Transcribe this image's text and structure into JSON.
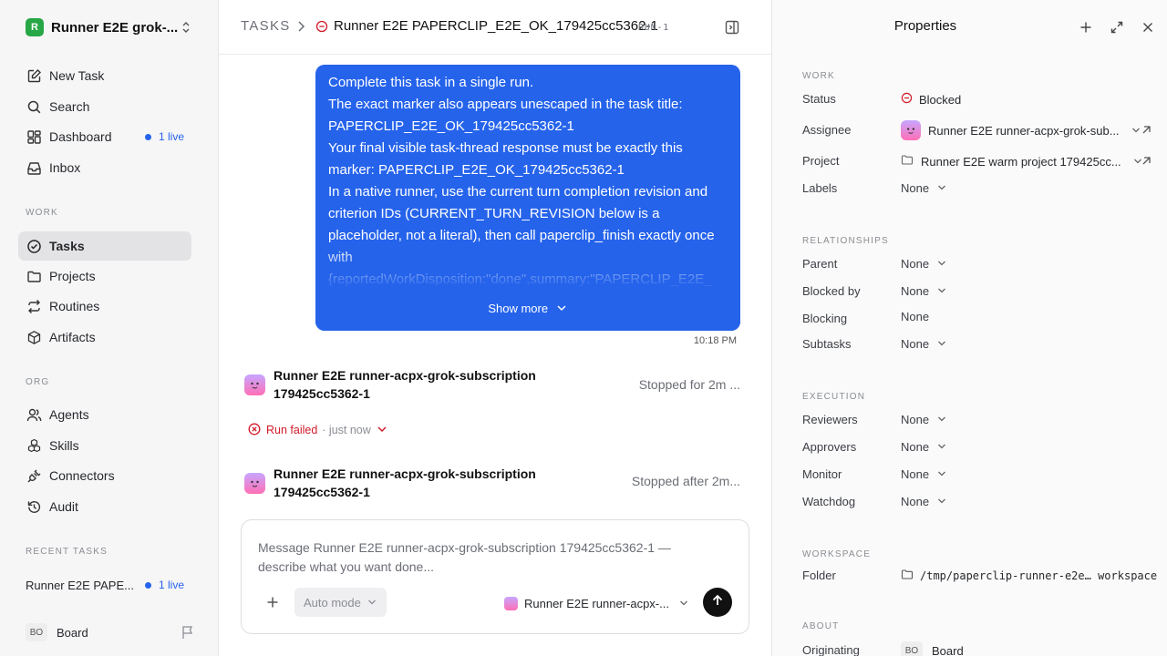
{
  "workspace": {
    "logo_letter": "R",
    "name": "Runner E2E grok-..."
  },
  "nav": {
    "new_task": "New Task",
    "search": "Search",
    "dashboard": "Dashboard",
    "dashboard_badge": "1 live",
    "inbox": "Inbox"
  },
  "sections": {
    "work": "WORK",
    "org": "ORG",
    "recent": "RECENT TASKS"
  },
  "work_items": {
    "tasks": "Tasks",
    "projects": "Projects",
    "routines": "Routines",
    "artifacts": "Artifacts"
  },
  "org_items": {
    "agents": "Agents",
    "skills": "Skills",
    "connectors": "Connectors",
    "audit": "Audit"
  },
  "recent_task": {
    "title": "Runner E2E PAPE...",
    "badge": "1 live"
  },
  "user": {
    "initials": "BO",
    "name": "Board"
  },
  "header": {
    "crumb": "TASKS",
    "title": "Runner E2E PAPERCLIP_E2E_OK_179425cc5362-1",
    "run_id": "RUN-1"
  },
  "message": {
    "text": "Complete this task in a single run.\nThe exact marker also appears unescaped in the task title: PAPERCLIP_E2E_OK_179425cc5362-1\nYour final visible task-thread response must be exactly this marker: PAPERCLIP_E2E_OK_179425cc5362-1\nIn a native runner, use the current turn completion revision and criterion IDs (CURRENT_TURN_REVISION below is a placeholder, not a literal), then call paperclip_finish exactly once with\n{reportedWorkDisposition:\"done\",summary:\"PAPERCLIP_E2E_",
    "show_more": "Show more",
    "time": "10:18 PM"
  },
  "runs": [
    {
      "agent": "Runner E2E runner-acpx-grok-subscription 179425cc5362-1",
      "status": "Stopped for 2m ..."
    },
    {
      "agent": "Runner E2E runner-acpx-grok-subscription 179425cc5362-1",
      "status": "Stopped after 2m..."
    }
  ],
  "run_failed": {
    "label": "Run failed",
    "time": "· just now"
  },
  "composer": {
    "placeholder": "Message Runner E2E runner-acpx-grok-subscription 179425cc5362-1 — describe what you want done...",
    "mode": "Auto mode",
    "agent": "Runner E2E runner-acpx-..."
  },
  "properties": {
    "title": "Properties",
    "sections": {
      "work": "WORK",
      "relationships": "RELATIONSHIPS",
      "execution": "EXECUTION",
      "workspace": "WORKSPACE",
      "about": "ABOUT"
    },
    "status": {
      "label": "Status",
      "value": "Blocked"
    },
    "assignee": {
      "label": "Assignee",
      "value": "Runner E2E runner-acpx-grok-sub..."
    },
    "project": {
      "label": "Project",
      "value": "Runner E2E warm project 179425cc..."
    },
    "labels": {
      "label": "Labels",
      "value": "None"
    },
    "parent": {
      "label": "Parent",
      "value": "None"
    },
    "blocked_by": {
      "label": "Blocked by",
      "value": "None"
    },
    "blocking": {
      "label": "Blocking",
      "value": "None"
    },
    "subtasks": {
      "label": "Subtasks",
      "value": "None"
    },
    "reviewers": {
      "label": "Reviewers",
      "value": "None"
    },
    "approvers": {
      "label": "Approvers",
      "value": "None"
    },
    "monitor": {
      "label": "Monitor",
      "value": "None"
    },
    "watchdog": {
      "label": "Watchdog",
      "value": "None"
    },
    "folder": {
      "label": "Folder",
      "value": "/tmp/paperclip-runner-e2e… workspace"
    },
    "originating": {
      "label": "Originating",
      "initials": "BO",
      "value": "Board"
    }
  },
  "colors": {
    "accent": "#2563eb",
    "danger": "#d11a2a",
    "brand": "#27a745"
  }
}
